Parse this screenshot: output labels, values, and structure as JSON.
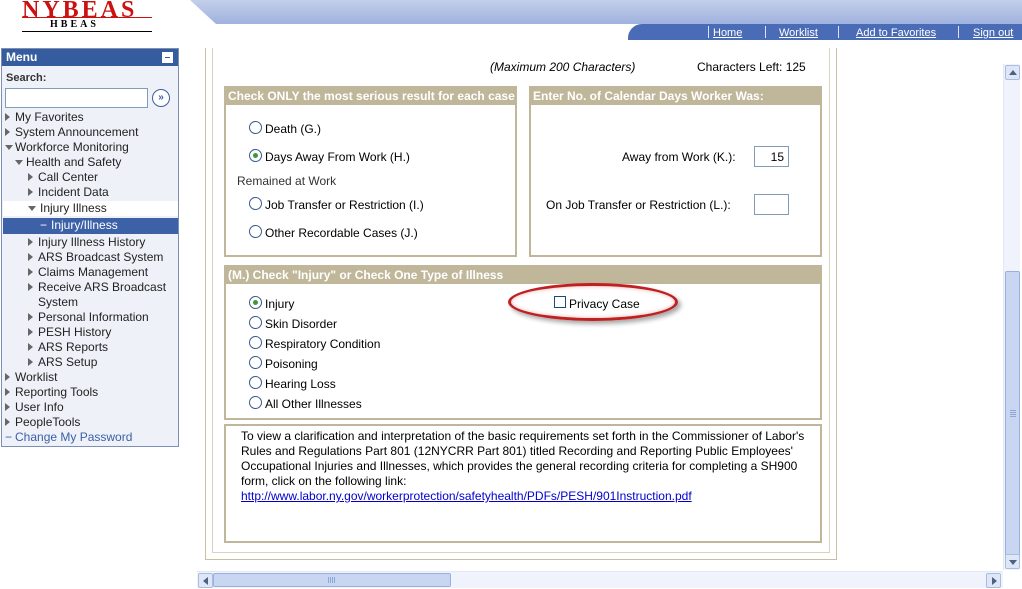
{
  "colors": {
    "nav_bar": "#4a6cb7",
    "menu_title_bg": "#355c9e",
    "panel_header_bg": "#c0b79a",
    "privacy_ring": "#c02020",
    "selected_radio_dot": "#3c9a3c"
  },
  "logo": {
    "main": "NYBEAS",
    "sub": "HBEAS"
  },
  "nav": {
    "home": "Home",
    "worklist": "Worklist",
    "add_favorites": "Add to Favorites",
    "sign_out": "Sign out"
  },
  "sidebar": {
    "title": "Menu",
    "search_label": "Search:",
    "search_value": "",
    "go_icon": "double-chevron-right-icon",
    "items": [
      {
        "label": "My Favorites"
      },
      {
        "label": "System Announcement"
      },
      {
        "label": "Workforce Monitoring"
      },
      {
        "label": "Health and Safety"
      },
      {
        "label": "Call Center"
      },
      {
        "label": "Incident Data"
      },
      {
        "label": "Injury Illness"
      },
      {
        "label": "Injury/Illness"
      },
      {
        "label": "Injury Illness History"
      },
      {
        "label": "ARS Broadcast System"
      },
      {
        "label": "Claims Management"
      },
      {
        "label": "Receive ARS Broadcast"
      },
      {
        "label": "System"
      },
      {
        "label": "Personal Information"
      },
      {
        "label": "PESH History"
      },
      {
        "label": "ARS Reports"
      },
      {
        "label": "ARS Setup"
      },
      {
        "label": "Worklist"
      },
      {
        "label": "Reporting Tools"
      },
      {
        "label": "User Info"
      },
      {
        "label": "PeopleTools"
      },
      {
        "label": "Change My Password"
      }
    ]
  },
  "form": {
    "max_chars": "(Maximum 200 Characters)",
    "chars_left": "Characters Left: 125",
    "result_panel": {
      "header": "Check ONLY the most serious result for each case",
      "death": "Death (G.)",
      "days_away": "Days Away From Work (H.)",
      "remained": "Remained at Work",
      "job_transfer": "Job Transfer or Restriction (I.)",
      "other": "Other Recordable Cases (J.)",
      "selected": "Days Away From Work (H.)"
    },
    "days_panel": {
      "header": "Enter No. of Calendar Days Worker Was:",
      "away_label": "Away from Work (K.):",
      "away_value": "15",
      "transfer_label": "On Job Transfer or Restriction (L.):",
      "transfer_value": ""
    },
    "illness_panel": {
      "header": "(M.) Check \"Injury\" or Check One Type of Illness",
      "options": [
        "Injury",
        "Skin Disorder",
        "Respiratory Condition",
        "Poisoning",
        "Hearing Loss",
        "All Other Illnesses"
      ],
      "selected": "Injury",
      "privacy_label": "Privacy Case",
      "privacy_checked": false
    },
    "info": {
      "text": "To view a clarification and interpretation of the basic requirements set forth in the Commissioner of Labor's Rules and Regulations Part 801 (12NYCRR Part 801) titled Recording and Reporting Public Employees' Occupational Injuries and Illnesses, which provides the general recording criteria for completing a SH900 form, click on the following link:",
      "link": "http://www.labor.ny.gov/workerprotection/safetyhealth/PDFs/PESH/901Instruction.pdf"
    }
  }
}
